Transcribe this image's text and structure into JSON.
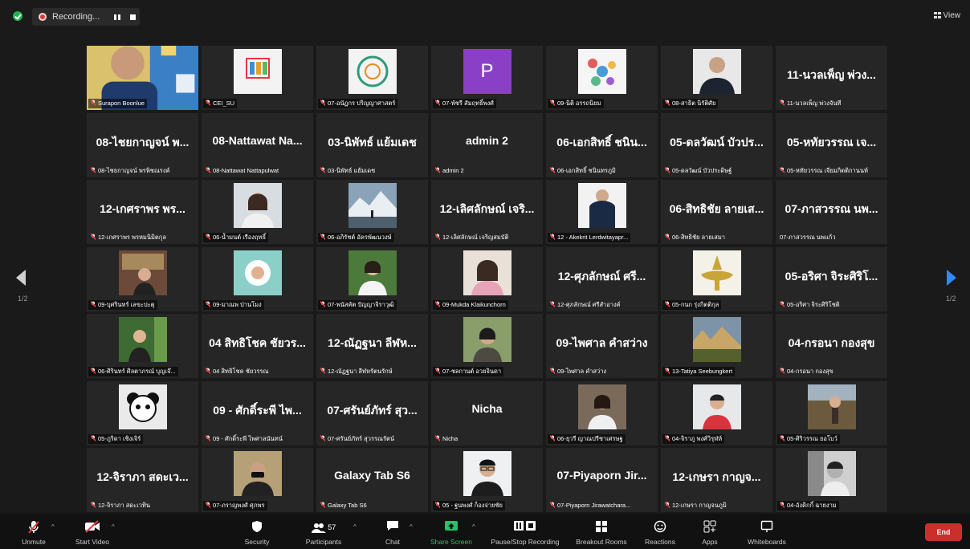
{
  "topbar": {
    "recording_label": "Recording...",
    "view_label": "View"
  },
  "page_indicator": {
    "left": "1/2",
    "right": "1/2"
  },
  "tiles": [
    {
      "name": "",
      "label": "Surapon Boonlue",
      "thumb": "video"
    },
    {
      "name": "",
      "label": "CEI_SU",
      "thumb": "logo-cei"
    },
    {
      "name": "",
      "label": "07-อนัฏกร ปริญญาศาสตร์",
      "thumb": "logo-green"
    },
    {
      "name": "",
      "label": "07-พัชรี สัมฤทธิ์พงศ์",
      "thumb": "letter-p",
      "letter": "P"
    },
    {
      "name": "",
      "label": "09-นิติ อรรถนิยม",
      "thumb": "logo-beads"
    },
    {
      "name": "",
      "label": "08-สาธิต นิรัติศัย",
      "thumb": "portrait-man"
    },
    {
      "name": "11-นวลเพ็ญ พ่วง...",
      "label": "11-นวลเพ็ญ พ่วงจันที"
    },
    {
      "name": "08-ไชยกาญจน์ พ...",
      "label": "08-ไชยกาญจน์ พรพิชณรงค์"
    },
    {
      "name": "08-Nattawat Na...",
      "label": "08-Nattawat Nattapulwat"
    },
    {
      "name": "03-นิพัทธ์ แย้มเดช",
      "label": "03-นิพัทธ์ แย้มเดช"
    },
    {
      "name": "admin 2",
      "label": "admin 2"
    },
    {
      "name": "06-เอกสิทธิ์ ชนิน...",
      "label": "06-เอกสิทธิ์ ชนินทรภูมิ"
    },
    {
      "name": "05-ดลวัฒน์ บัวปร...",
      "label": "05-ดลวัฒน์ บัวประดิษฐ์"
    },
    {
      "name": "05-หทัยวรรณ เจ...",
      "label": "05-หทัยวรรณ เจียมกิตติกานนท์"
    },
    {
      "name": "12-เกศราพร พร...",
      "label": "12-เกศราพร พรหมนิมิตกุล"
    },
    {
      "name": "",
      "label": "06-น้ำมนต์ เรืองฤทธิ์",
      "thumb": "portrait-woman"
    },
    {
      "name": "",
      "label": "06-อภิรัชต์ อัครพัฒนวงษ์",
      "thumb": "landscape-snow"
    },
    {
      "name": "12-เลิศลักษณ์ เจริ...",
      "label": "12-เลิศลักษณ์ เจริญสมบัติ"
    },
    {
      "name": "",
      "label": "12 - Akekrit Lerdwitayapr...",
      "thumb": "portrait-suit"
    },
    {
      "name": "06-สิทธิชัย ลายเส...",
      "label": "06-สิทธิชัย ลายเสมา"
    },
    {
      "name": "07-ภาสวรรณ นพ...",
      "label": "07-ภาสวรรณ นพแก้ว",
      "nomic": true
    },
    {
      "name": "",
      "label": "09-บุศรินทร์ เลขะปะตุ",
      "thumb": "portrait-woman2"
    },
    {
      "name": "",
      "label": "09-มาณพ ป่านโมง",
      "thumb": "logo-circle"
    },
    {
      "name": "",
      "label": "07-พนัสคัต ปัญญาจิราวุฒิ",
      "thumb": "portrait-green"
    },
    {
      "name": "",
      "label": "09-Mukda Klaikunchorn",
      "thumb": "portrait-woman3"
    },
    {
      "name": "12-ศุภลักษณ์ ศรี...",
      "label": "12-ศุภลักษณ์ ศรีสำอางค์"
    },
    {
      "name": "",
      "label": "05-กนก รุ่งกิตติกุล",
      "thumb": "logo-gold"
    },
    {
      "name": "05-อริศา จิระศิริโ...",
      "label": "05-อริศา จิระศิริโชติ"
    },
    {
      "name": "",
      "label": "06-ศิรินทร์ ศิลตาภรณ์ บุญเจ๊...",
      "thumb": "portrait-tree"
    },
    {
      "name": "04 สิทธิโชค ชัยวร...",
      "label": "04 สิทธิโชค ชัยวรรณ"
    },
    {
      "name": "12-ณัฏฐนา ลีฬห...",
      "label": "12-ณัฏฐนา ลีฬหรัตนรักษ์"
    },
    {
      "name": "",
      "label": "07-ชลกานต์ อวยจินดา",
      "thumb": "portrait-outdoor"
    },
    {
      "name": "09-ไพศาล คำสว่าง",
      "label": "09-ไพศาล คำสว่าง"
    },
    {
      "name": "",
      "label": "13-Tatiya Seebungkert",
      "thumb": "landscape-trees"
    },
    {
      "name": "04-กรอนา กองสุข",
      "label": "04-กรอนา กองสุข"
    },
    {
      "name": "",
      "label": "05-ภูริดา เชิงเจิร์",
      "thumb": "cartoon"
    },
    {
      "name": "09 - ศักดิ์ระพี ไพ...",
      "label": "09 - ศักดิ์ระพี ไพศาลนันทน์"
    },
    {
      "name": "07-ศรันย์ภัทร์ สุว...",
      "label": "07-ศรันย์ภัทร์ สุวรรณรัตน์"
    },
    {
      "name": "Nicha",
      "label": "Nicha"
    },
    {
      "name": "",
      "label": "06-ยุวรี ญาณปรีชาเศรษฐ",
      "thumb": "portrait-desk"
    },
    {
      "name": "",
      "label": "04-จิราภู พงศ์วิรุฬห์",
      "thumb": "portrait-red"
    },
    {
      "name": "",
      "label": "05-ศิริวรรณ ยอโบว์",
      "thumb": "portrait-field"
    },
    {
      "name": "12-จิราภา สดะเว...",
      "label": "12-จิราภา สดะเวทิน"
    },
    {
      "name": "",
      "label": "07-ภราญพงศ์ ศุภพร",
      "thumb": "portrait-mask"
    },
    {
      "name": "Galaxy Tab S6",
      "label": "Galaxy Tab S6"
    },
    {
      "name": "",
      "label": "05 - ฐนพงศ์ ก็องจ่ายชัย",
      "thumb": "portrait-glasses"
    },
    {
      "name": "07-Piyaporn Jir...",
      "label": "07-Piyaporn Jirawatchara..."
    },
    {
      "name": "12-เกษรา กาญจ...",
      "label": "12-เกษรา กาญจนภูมิ"
    },
    {
      "name": "",
      "label": "04-อังคิกกิ์ ฉายงาม",
      "thumb": "portrait-bw"
    }
  ],
  "toolbar": {
    "unmute": "Unmute",
    "start_video": "Start Video",
    "security": "Security",
    "participants": "Participants",
    "participants_count": "57",
    "chat": "Chat",
    "share_screen": "Share Screen",
    "pause_recording": "Pause/Stop Recording",
    "breakout": "Breakout Rooms",
    "reactions": "Reactions",
    "apps": "Apps",
    "whiteboards": "Whiteboards",
    "end": "End"
  },
  "colors": {
    "background": "#1a1a1a",
    "tile": "#262626",
    "active_speaker": "#e6e34d",
    "share_green": "#23c46a",
    "end_red": "#c9302c",
    "nav_blue": "#2d8cff"
  }
}
